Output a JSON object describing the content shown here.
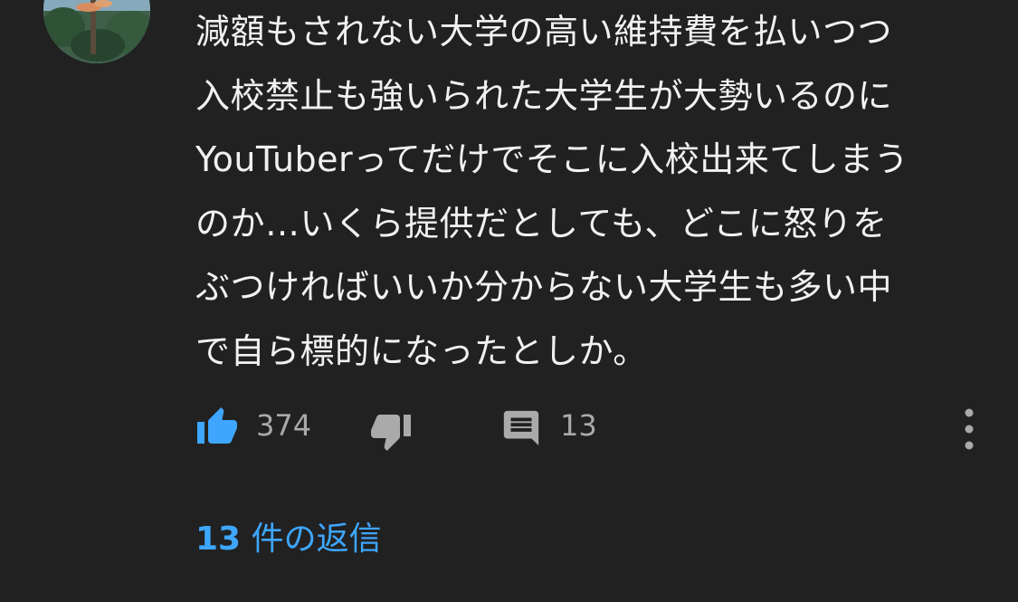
{
  "comment": {
    "lines": [
      "減額もされない大学の高い維持費を払いつつ",
      "入校禁止も強いられた大学生が大勢いるのに",
      "YouTuberってだけでそこに入校出来てしまう",
      "のか…いくら提供だとしても、どこに怒りを",
      "ぶつければいいか分からない大学生も多い中",
      "で自ら標的になったとしか。"
    ]
  },
  "actions": {
    "like_count": "374",
    "reply_count": "13",
    "icons": {
      "like": "thumb-up-icon",
      "dislike": "thumb-down-icon",
      "reply": "comment-icon",
      "more": "more-vert-icon"
    }
  },
  "replies": {
    "count": "13",
    "label": "件の返信"
  },
  "colors": {
    "background": "#212121",
    "text": "#f1f1f1",
    "secondary_text": "#aaaaaa",
    "accent": "#3ea6ff"
  }
}
